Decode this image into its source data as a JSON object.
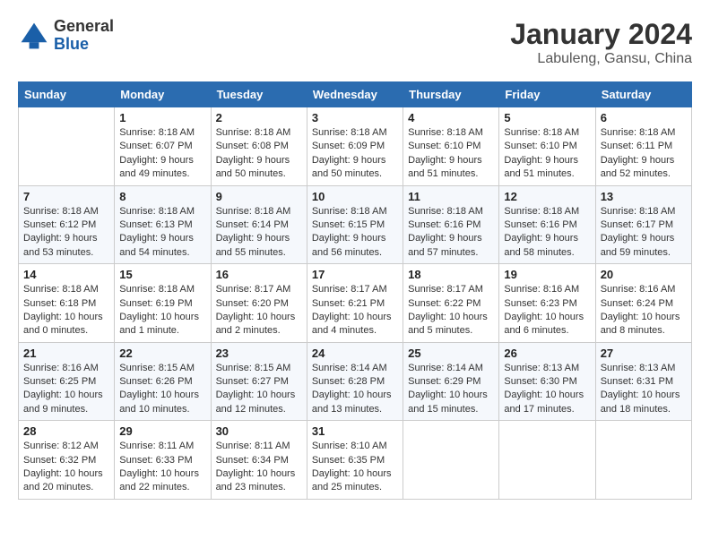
{
  "header": {
    "logo_general": "General",
    "logo_blue": "Blue",
    "month": "January 2024",
    "location": "Labuleng, Gansu, China"
  },
  "weekdays": [
    "Sunday",
    "Monday",
    "Tuesday",
    "Wednesday",
    "Thursday",
    "Friday",
    "Saturday"
  ],
  "weeks": [
    [
      {
        "day": "",
        "info": ""
      },
      {
        "day": "1",
        "info": "Sunrise: 8:18 AM\nSunset: 6:07 PM\nDaylight: 9 hours\nand 49 minutes."
      },
      {
        "day": "2",
        "info": "Sunrise: 8:18 AM\nSunset: 6:08 PM\nDaylight: 9 hours\nand 50 minutes."
      },
      {
        "day": "3",
        "info": "Sunrise: 8:18 AM\nSunset: 6:09 PM\nDaylight: 9 hours\nand 50 minutes."
      },
      {
        "day": "4",
        "info": "Sunrise: 8:18 AM\nSunset: 6:10 PM\nDaylight: 9 hours\nand 51 minutes."
      },
      {
        "day": "5",
        "info": "Sunrise: 8:18 AM\nSunset: 6:10 PM\nDaylight: 9 hours\nand 51 minutes."
      },
      {
        "day": "6",
        "info": "Sunrise: 8:18 AM\nSunset: 6:11 PM\nDaylight: 9 hours\nand 52 minutes."
      }
    ],
    [
      {
        "day": "7",
        "info": "Sunrise: 8:18 AM\nSunset: 6:12 PM\nDaylight: 9 hours\nand 53 minutes."
      },
      {
        "day": "8",
        "info": "Sunrise: 8:18 AM\nSunset: 6:13 PM\nDaylight: 9 hours\nand 54 minutes."
      },
      {
        "day": "9",
        "info": "Sunrise: 8:18 AM\nSunset: 6:14 PM\nDaylight: 9 hours\nand 55 minutes."
      },
      {
        "day": "10",
        "info": "Sunrise: 8:18 AM\nSunset: 6:15 PM\nDaylight: 9 hours\nand 56 minutes."
      },
      {
        "day": "11",
        "info": "Sunrise: 8:18 AM\nSunset: 6:16 PM\nDaylight: 9 hours\nand 57 minutes."
      },
      {
        "day": "12",
        "info": "Sunrise: 8:18 AM\nSunset: 6:16 PM\nDaylight: 9 hours\nand 58 minutes."
      },
      {
        "day": "13",
        "info": "Sunrise: 8:18 AM\nSunset: 6:17 PM\nDaylight: 9 hours\nand 59 minutes."
      }
    ],
    [
      {
        "day": "14",
        "info": "Sunrise: 8:18 AM\nSunset: 6:18 PM\nDaylight: 10 hours\nand 0 minutes."
      },
      {
        "day": "15",
        "info": "Sunrise: 8:18 AM\nSunset: 6:19 PM\nDaylight: 10 hours\nand 1 minute."
      },
      {
        "day": "16",
        "info": "Sunrise: 8:17 AM\nSunset: 6:20 PM\nDaylight: 10 hours\nand 2 minutes."
      },
      {
        "day": "17",
        "info": "Sunrise: 8:17 AM\nSunset: 6:21 PM\nDaylight: 10 hours\nand 4 minutes."
      },
      {
        "day": "18",
        "info": "Sunrise: 8:17 AM\nSunset: 6:22 PM\nDaylight: 10 hours\nand 5 minutes."
      },
      {
        "day": "19",
        "info": "Sunrise: 8:16 AM\nSunset: 6:23 PM\nDaylight: 10 hours\nand 6 minutes."
      },
      {
        "day": "20",
        "info": "Sunrise: 8:16 AM\nSunset: 6:24 PM\nDaylight: 10 hours\nand 8 minutes."
      }
    ],
    [
      {
        "day": "21",
        "info": "Sunrise: 8:16 AM\nSunset: 6:25 PM\nDaylight: 10 hours\nand 9 minutes."
      },
      {
        "day": "22",
        "info": "Sunrise: 8:15 AM\nSunset: 6:26 PM\nDaylight: 10 hours\nand 10 minutes."
      },
      {
        "day": "23",
        "info": "Sunrise: 8:15 AM\nSunset: 6:27 PM\nDaylight: 10 hours\nand 12 minutes."
      },
      {
        "day": "24",
        "info": "Sunrise: 8:14 AM\nSunset: 6:28 PM\nDaylight: 10 hours\nand 13 minutes."
      },
      {
        "day": "25",
        "info": "Sunrise: 8:14 AM\nSunset: 6:29 PM\nDaylight: 10 hours\nand 15 minutes."
      },
      {
        "day": "26",
        "info": "Sunrise: 8:13 AM\nSunset: 6:30 PM\nDaylight: 10 hours\nand 17 minutes."
      },
      {
        "day": "27",
        "info": "Sunrise: 8:13 AM\nSunset: 6:31 PM\nDaylight: 10 hours\nand 18 minutes."
      }
    ],
    [
      {
        "day": "28",
        "info": "Sunrise: 8:12 AM\nSunset: 6:32 PM\nDaylight: 10 hours\nand 20 minutes."
      },
      {
        "day": "29",
        "info": "Sunrise: 8:11 AM\nSunset: 6:33 PM\nDaylight: 10 hours\nand 22 minutes."
      },
      {
        "day": "30",
        "info": "Sunrise: 8:11 AM\nSunset: 6:34 PM\nDaylight: 10 hours\nand 23 minutes."
      },
      {
        "day": "31",
        "info": "Sunrise: 8:10 AM\nSunset: 6:35 PM\nDaylight: 10 hours\nand 25 minutes."
      },
      {
        "day": "",
        "info": ""
      },
      {
        "day": "",
        "info": ""
      },
      {
        "day": "",
        "info": ""
      }
    ]
  ]
}
